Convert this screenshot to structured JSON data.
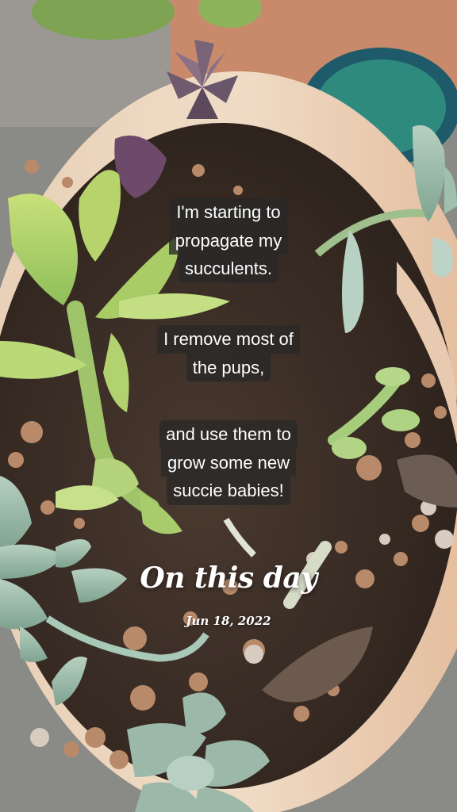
{
  "captions": [
    {
      "lines": [
        "I'm starting to",
        "propagate my",
        "succulents."
      ]
    },
    {
      "lines": [
        "I remove most of",
        "the pups,"
      ]
    },
    {
      "lines": [
        "and use them to",
        "grow some new",
        "succie babies!"
      ]
    }
  ],
  "memory": {
    "title": "On this day",
    "date": "Jun 18, 2022"
  }
}
